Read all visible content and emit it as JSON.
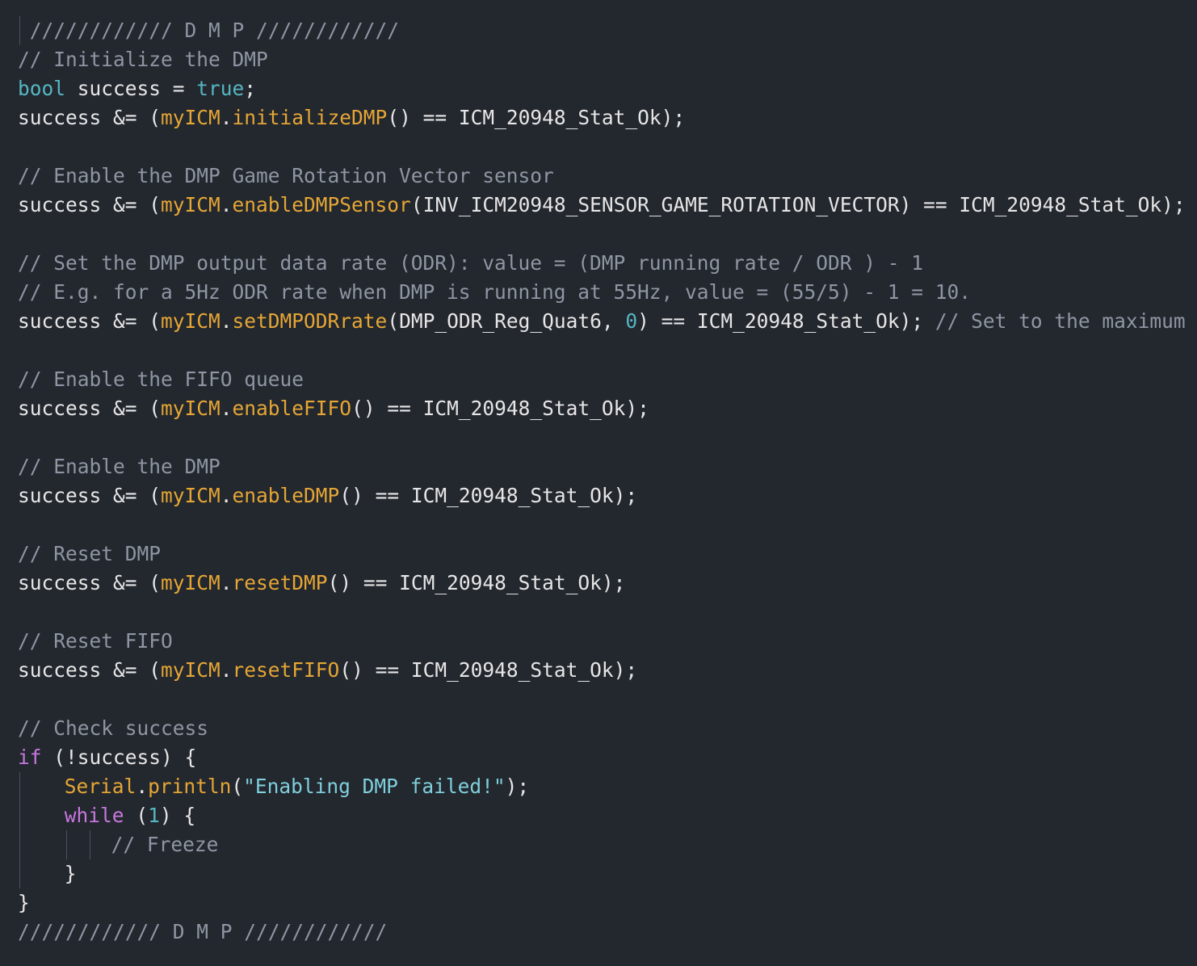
{
  "editor": {
    "lines": [
      {
        "indent": 0,
        "guides": [
          1
        ],
        "tokens": [
          {
            "t": " //////////// D M P ////////////",
            "c": "c-comment"
          }
        ]
      },
      {
        "indent": 0,
        "guides": [],
        "tokens": [
          {
            "t": "// Initialize the DMP",
            "c": "c-comment"
          }
        ]
      },
      {
        "indent": 0,
        "guides": [],
        "tokens": [
          {
            "t": "bool",
            "c": "c-type"
          },
          {
            "t": " success = ",
            "c": "c-plain"
          },
          {
            "t": "true",
            "c": "c-lit"
          },
          {
            "t": ";",
            "c": "c-plain"
          }
        ]
      },
      {
        "indent": 0,
        "guides": [],
        "tokens": [
          {
            "t": "success &= (",
            "c": "c-plain"
          },
          {
            "t": "myICM",
            "c": "c-obj"
          },
          {
            "t": ".",
            "c": "c-plain"
          },
          {
            "t": "initializeDMP",
            "c": "c-fn"
          },
          {
            "t": "() == ICM_20948_Stat_Ok);",
            "c": "c-plain"
          }
        ]
      },
      {
        "indent": 0,
        "guides": [],
        "tokens": []
      },
      {
        "indent": 0,
        "guides": [],
        "tokens": [
          {
            "t": "// Enable the DMP Game Rotation Vector sensor",
            "c": "c-comment"
          }
        ]
      },
      {
        "indent": 0,
        "guides": [],
        "tokens": [
          {
            "t": "success &= (",
            "c": "c-plain"
          },
          {
            "t": "myICM",
            "c": "c-obj"
          },
          {
            "t": ".",
            "c": "c-plain"
          },
          {
            "t": "enableDMPSensor",
            "c": "c-fn"
          },
          {
            "t": "(INV_ICM20948_SENSOR_GAME_ROTATION_VECTOR) == ICM_20948_Stat_Ok);",
            "c": "c-plain"
          }
        ]
      },
      {
        "indent": 0,
        "guides": [],
        "tokens": []
      },
      {
        "indent": 0,
        "guides": [],
        "tokens": [
          {
            "t": "// Set the DMP output data rate (ODR): value = (DMP running rate / ODR ) - 1",
            "c": "c-comment"
          }
        ]
      },
      {
        "indent": 0,
        "guides": [],
        "tokens": [
          {
            "t": "// E.g. for a 5Hz ODR rate when DMP is running at 55Hz, value = (55/5) - 1 = 10.",
            "c": "c-comment"
          }
        ]
      },
      {
        "indent": 0,
        "guides": [],
        "tokens": [
          {
            "t": "success &= (",
            "c": "c-plain"
          },
          {
            "t": "myICM",
            "c": "c-obj"
          },
          {
            "t": ".",
            "c": "c-plain"
          },
          {
            "t": "setDMPODRrate",
            "c": "c-fn"
          },
          {
            "t": "(DMP_ODR_Reg_Quat6, ",
            "c": "c-plain"
          },
          {
            "t": "0",
            "c": "c-num"
          },
          {
            "t": ") == ICM_20948_Stat_Ok); ",
            "c": "c-plain"
          },
          {
            "t": "// Set to the maximum",
            "c": "c-comment"
          }
        ]
      },
      {
        "indent": 0,
        "guides": [],
        "tokens": []
      },
      {
        "indent": 0,
        "guides": [],
        "tokens": [
          {
            "t": "// Enable the FIFO queue",
            "c": "c-comment"
          }
        ]
      },
      {
        "indent": 0,
        "guides": [],
        "tokens": [
          {
            "t": "success &= (",
            "c": "c-plain"
          },
          {
            "t": "myICM",
            "c": "c-obj"
          },
          {
            "t": ".",
            "c": "c-plain"
          },
          {
            "t": "enableFIFO",
            "c": "c-fn"
          },
          {
            "t": "() == ICM_20948_Stat_Ok);",
            "c": "c-plain"
          }
        ]
      },
      {
        "indent": 0,
        "guides": [],
        "tokens": []
      },
      {
        "indent": 0,
        "guides": [],
        "tokens": [
          {
            "t": "// Enable the DMP",
            "c": "c-comment"
          }
        ]
      },
      {
        "indent": 0,
        "guides": [],
        "tokens": [
          {
            "t": "success &= (",
            "c": "c-plain"
          },
          {
            "t": "myICM",
            "c": "c-obj"
          },
          {
            "t": ".",
            "c": "c-plain"
          },
          {
            "t": "enableDMP",
            "c": "c-fn"
          },
          {
            "t": "() == ICM_20948_Stat_Ok);",
            "c": "c-plain"
          }
        ]
      },
      {
        "indent": 0,
        "guides": [],
        "tokens": []
      },
      {
        "indent": 0,
        "guides": [],
        "tokens": [
          {
            "t": "// Reset DMP",
            "c": "c-comment"
          }
        ]
      },
      {
        "indent": 0,
        "guides": [],
        "tokens": [
          {
            "t": "success &= (",
            "c": "c-plain"
          },
          {
            "t": "myICM",
            "c": "c-obj"
          },
          {
            "t": ".",
            "c": "c-plain"
          },
          {
            "t": "resetDMP",
            "c": "c-fn"
          },
          {
            "t": "() == ICM_20948_Stat_Ok);",
            "c": "c-plain"
          }
        ]
      },
      {
        "indent": 0,
        "guides": [],
        "tokens": []
      },
      {
        "indent": 0,
        "guides": [],
        "tokens": [
          {
            "t": "// Reset FIFO",
            "c": "c-comment"
          }
        ]
      },
      {
        "indent": 0,
        "guides": [],
        "tokens": [
          {
            "t": "success &= (",
            "c": "c-plain"
          },
          {
            "t": "myICM",
            "c": "c-obj"
          },
          {
            "t": ".",
            "c": "c-plain"
          },
          {
            "t": "resetFIFO",
            "c": "c-fn"
          },
          {
            "t": "() == ICM_20948_Stat_Ok);",
            "c": "c-plain"
          }
        ]
      },
      {
        "indent": 0,
        "guides": [],
        "tokens": []
      },
      {
        "indent": 0,
        "guides": [],
        "tokens": [
          {
            "t": "// Check success",
            "c": "c-comment"
          }
        ]
      },
      {
        "indent": 0,
        "guides": [],
        "tokens": [
          {
            "t": "if",
            "c": "c-kw"
          },
          {
            "t": " (!success) {",
            "c": "c-plain"
          }
        ]
      },
      {
        "indent": 4,
        "guides": [
          1
        ],
        "tokens": [
          {
            "t": "Serial",
            "c": "c-obj"
          },
          {
            "t": ".",
            "c": "c-plain"
          },
          {
            "t": "println",
            "c": "c-fn"
          },
          {
            "t": "(",
            "c": "c-plain"
          },
          {
            "t": "\"Enabling DMP failed!\"",
            "c": "c-str"
          },
          {
            "t": ");",
            "c": "c-plain"
          }
        ]
      },
      {
        "indent": 4,
        "guides": [
          1
        ],
        "tokens": [
          {
            "t": "while",
            "c": "c-kw"
          },
          {
            "t": " (",
            "c": "c-plain"
          },
          {
            "t": "1",
            "c": "c-num"
          },
          {
            "t": ") {",
            "c": "c-plain"
          }
        ]
      },
      {
        "indent": 8,
        "guides": [
          1,
          5,
          7
        ],
        "tokens": [
          {
            "t": "// Freeze",
            "c": "c-comment"
          }
        ]
      },
      {
        "indent": 4,
        "guides": [
          1
        ],
        "tokens": [
          {
            "t": "}",
            "c": "c-plain"
          }
        ]
      },
      {
        "indent": 0,
        "guides": [],
        "tokens": [
          {
            "t": "}",
            "c": "c-plain"
          }
        ]
      },
      {
        "indent": 0,
        "guides": [],
        "tokens": [
          {
            "t": "//////////// D M P ////////////",
            "c": "c-comment"
          }
        ]
      }
    ]
  }
}
